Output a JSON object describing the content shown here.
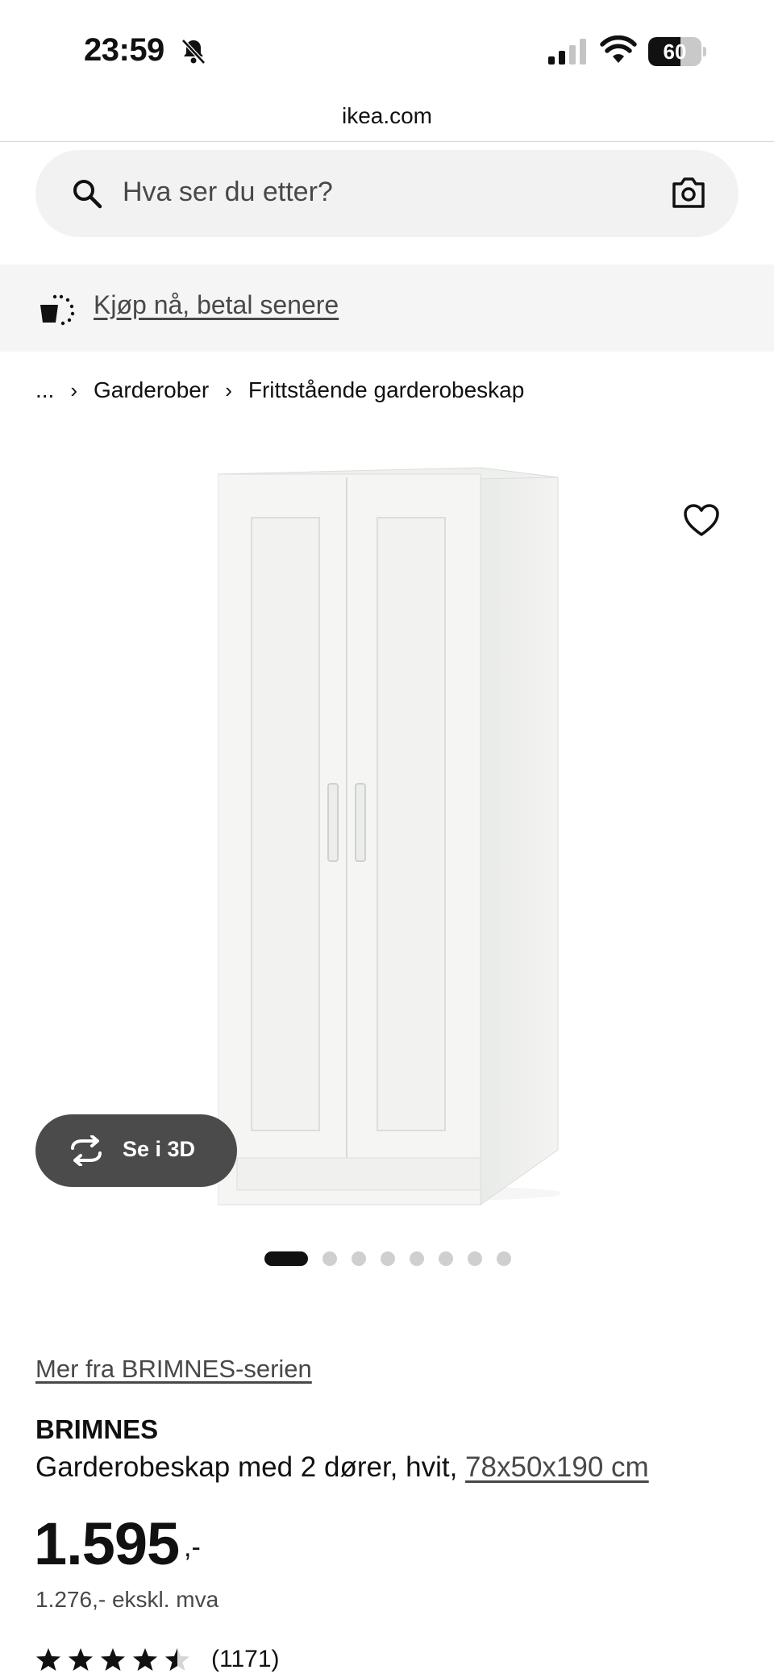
{
  "status_bar": {
    "time": "23:59",
    "battery_level": "60",
    "battery_fraction": 0.6,
    "icons": [
      "bell-slash-icon",
      "cellular-signal-icon",
      "wifi-icon",
      "battery-icon"
    ]
  },
  "browser": {
    "url": "ikea.com"
  },
  "search": {
    "placeholder": "Hva ser du etter?",
    "icons": [
      "search-icon",
      "camera-icon"
    ]
  },
  "promo": {
    "label": "Kjøp nå, betal senere",
    "icon": "shopping-bag-icon"
  },
  "breadcrumb": {
    "ellipsis": "...",
    "items": [
      "Garderober",
      "Frittstående garderobeskap"
    ],
    "separator": "›"
  },
  "gallery": {
    "view_3d_label": "Se i 3D",
    "slide_count": 8,
    "active_slide": 1,
    "icons": [
      "heart-icon",
      "rotate-3d-icon"
    ]
  },
  "product": {
    "series_link": "Mer fra BRIMNES-serien",
    "name": "BRIMNES",
    "description": "Garderobeskap med 2 dører, hvit, ",
    "dimensions": "78x50x190 cm",
    "price_main": "1.595",
    "price_suffix": ",-",
    "price_ex_vat": "1.276,- ekskl. mva",
    "rating_value": 4.5,
    "rating_max": 5,
    "rating_count": "(1171)"
  },
  "colors": {
    "text": "#111111",
    "muted": "#484848",
    "button_dark": "#4b4b4b",
    "surface": "#f2f2f2"
  }
}
